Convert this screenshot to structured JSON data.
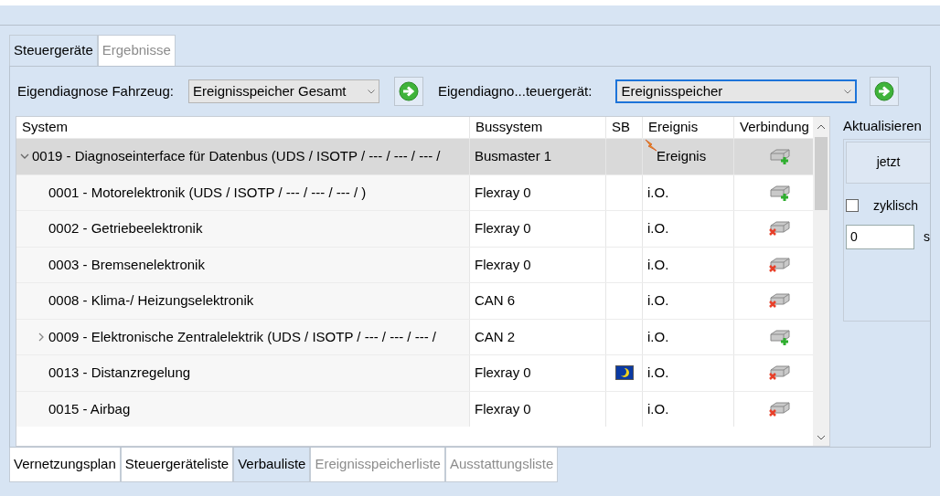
{
  "tabs": [
    {
      "label": "Steuergeräte",
      "selected": true,
      "disabled": false
    },
    {
      "label": "Ergebnisse",
      "selected": false,
      "disabled": true
    }
  ],
  "toolbar": {
    "vehicle_label": "Eigendiagnose Fahrzeug:",
    "vehicle_select": "Ereignisspeicher Gesamt",
    "unit_label": "Eigendiagno...teuergerät:",
    "unit_select": "Ereignisspeicher"
  },
  "table": {
    "columns": [
      "System",
      "Bussystem",
      "SB",
      "Ereignis",
      "Verbindung"
    ],
    "rows": [
      {
        "system": "0019 - Diagnoseinterface für Datenbus  (UDS / ISOTP / --- / --- / --- /",
        "bus": "Busmaster 1",
        "sleep": false,
        "event": "Ereignis",
        "event_flag": true,
        "connected": true,
        "selected": true,
        "expanded": true,
        "children": [
          {
            "system": "0001 - Motorelektronik  (UDS / ISOTP / --- / --- / --- /  )",
            "bus": "Flexray 0",
            "sleep": false,
            "event": "i.O.",
            "event_flag": false,
            "connected": true,
            "selected": false
          },
          {
            "system": "0002 - Getriebeelektronik",
            "bus": "Flexray 0",
            "sleep": false,
            "event": "i.O.",
            "event_flag": false,
            "connected": false,
            "selected": false
          },
          {
            "system": "0003 - Bremsenelektronik",
            "bus": "Flexray 0",
            "sleep": false,
            "event": "i.O.",
            "event_flag": false,
            "connected": false,
            "selected": false
          },
          {
            "system": "0008 - Klima-/ Heizungselektronik",
            "bus": "CAN 6",
            "sleep": false,
            "event": "i.O.",
            "event_flag": false,
            "connected": false,
            "selected": false
          },
          {
            "system": "0009 - Elektronische Zentralelektrik  (UDS / ISOTP / --- / --- / --- /",
            "bus": "CAN 2",
            "sleep": false,
            "event": "i.O.",
            "event_flag": false,
            "connected": true,
            "selected": false,
            "expanded": false
          },
          {
            "system": "0013 - Distanzregelung",
            "bus": "Flexray 0",
            "sleep": true,
            "event": "i.O.",
            "event_flag": false,
            "connected": false,
            "selected": false
          },
          {
            "system": "0015 - Airbag",
            "bus": "Flexray 0",
            "sleep": false,
            "event": "i.O.",
            "event_flag": false,
            "connected": false,
            "selected": false
          }
        ]
      }
    ]
  },
  "refresh": {
    "title": "Aktualisieren",
    "now_button": "jetzt",
    "cyclic_label": "zyklisch",
    "cyclic": false,
    "interval": "0",
    "unit": "s"
  },
  "bottom_tabs": [
    {
      "label": "Vernetzungsplan",
      "selected": false,
      "disabled": false
    },
    {
      "label": "Steuergeräteliste",
      "selected": false,
      "disabled": false
    },
    {
      "label": "Verbauliste",
      "selected": true,
      "disabled": false
    },
    {
      "label": "Ereignisspeicherliste",
      "selected": false,
      "disabled": true
    },
    {
      "label": "Ausstattungsliste",
      "selected": false,
      "disabled": true
    }
  ]
}
